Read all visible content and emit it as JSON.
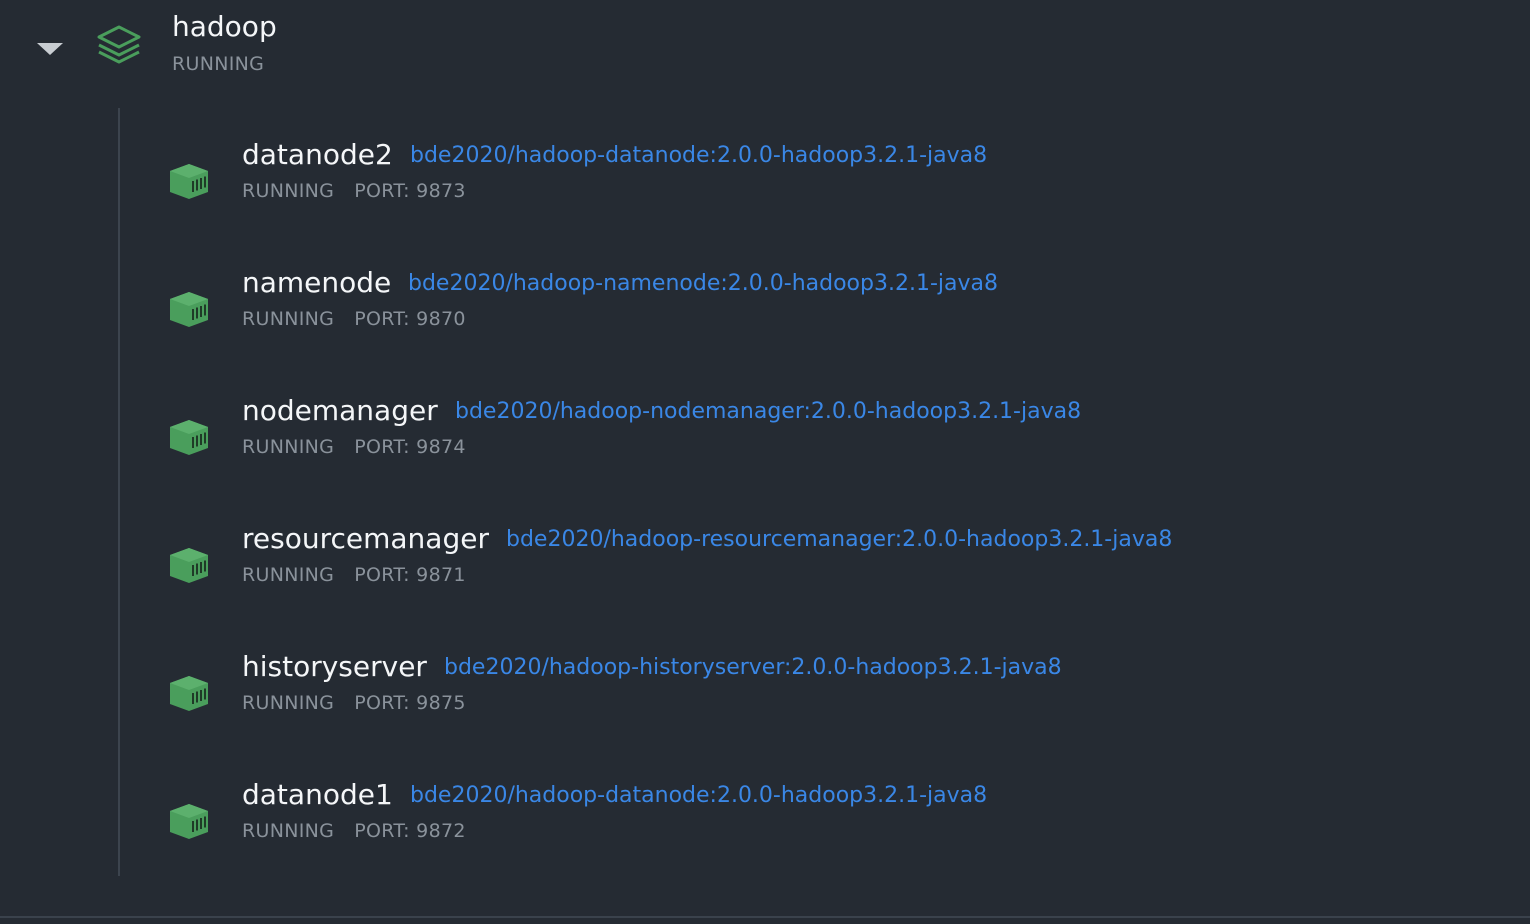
{
  "stack": {
    "name": "hadoop",
    "status": "RUNNING",
    "icon": "stack-layers-icon",
    "accent_color": "#4a9e5c"
  },
  "containers": [
    {
      "name": "datanode2",
      "image": "bde2020/hadoop-datanode:2.0.0-hadoop3.2.1-java8",
      "status": "RUNNING",
      "port": "PORT: 9873"
    },
    {
      "name": "namenode",
      "image": "bde2020/hadoop-namenode:2.0.0-hadoop3.2.1-java8",
      "status": "RUNNING",
      "port": "PORT: 9870"
    },
    {
      "name": "nodemanager",
      "image": "bde2020/hadoop-nodemanager:2.0.0-hadoop3.2.1-java8",
      "status": "RUNNING",
      "port": "PORT: 9874"
    },
    {
      "name": "resourcemanager",
      "image": "bde2020/hadoop-resourcemanager:2.0.0-hadoop3.2.1-java8",
      "status": "RUNNING",
      "port": "PORT: 9871"
    },
    {
      "name": "historyserver",
      "image": "bde2020/hadoop-historyserver:2.0.0-hadoop3.2.1-java8",
      "status": "RUNNING",
      "port": "PORT: 9875"
    },
    {
      "name": "datanode1",
      "image": "bde2020/hadoop-datanode:2.0.0-hadoop3.2.1-java8",
      "status": "RUNNING",
      "port": "PORT: 9872"
    }
  ],
  "colors": {
    "background": "#252b33",
    "running_green": "#4a9e5c",
    "link_blue": "#3a87e6",
    "muted_text": "#8a929b"
  }
}
